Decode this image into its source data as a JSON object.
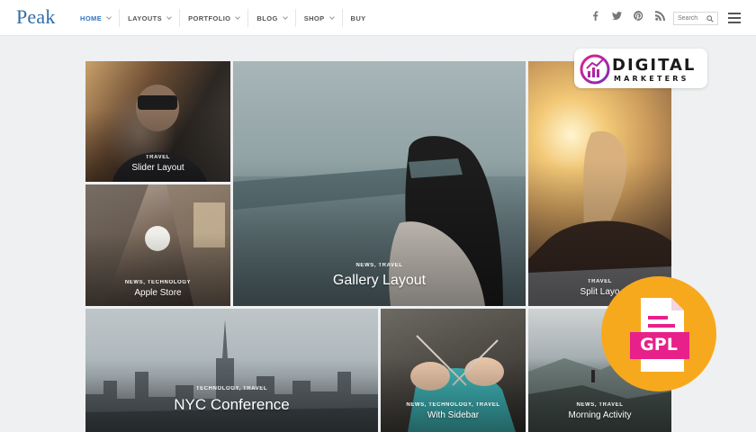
{
  "header": {
    "logo": "Peak",
    "nav": [
      {
        "label": "HOME",
        "active": true,
        "dropdown": true
      },
      {
        "label": "LAYOUTS",
        "active": false,
        "dropdown": true
      },
      {
        "label": "PORTFOLIO",
        "active": false,
        "dropdown": true
      },
      {
        "label": "BLOG",
        "active": false,
        "dropdown": true
      },
      {
        "label": "SHOP",
        "active": false,
        "dropdown": true
      },
      {
        "label": "BUY",
        "active": false,
        "dropdown": false
      }
    ],
    "social": [
      "facebook-icon",
      "twitter-icon",
      "pinterest-icon",
      "rss-icon"
    ],
    "search_placeholder": "Search"
  },
  "tiles": {
    "slider": {
      "category": "TRAVEL",
      "title": "Slider Layout"
    },
    "apple": {
      "category": "NEWS, TECHNOLOGY",
      "title": "Apple Store"
    },
    "gallery": {
      "category": "NEWS, TRAVEL",
      "title": "Gallery Layout"
    },
    "split": {
      "category": "TRAVEL",
      "title": "Split Layo"
    },
    "nyc": {
      "category": "TECHNOLOGY, TRAVEL",
      "title": "NYC Conference"
    },
    "sidebar": {
      "category": "NEWS, TECHNOLOGY, TRAVEL",
      "title": "With Sidebar"
    },
    "morning": {
      "category": "NEWS, TRAVEL",
      "title": "Morning Activity"
    }
  },
  "badges": {
    "dm_line1": "DIGITAL",
    "dm_line2": "MARKETERS",
    "gpl": "GPL"
  },
  "colors": {
    "accent": "#2f73c0",
    "gpl_orange": "#f7a91d",
    "gpl_pink": "#e8208a"
  }
}
